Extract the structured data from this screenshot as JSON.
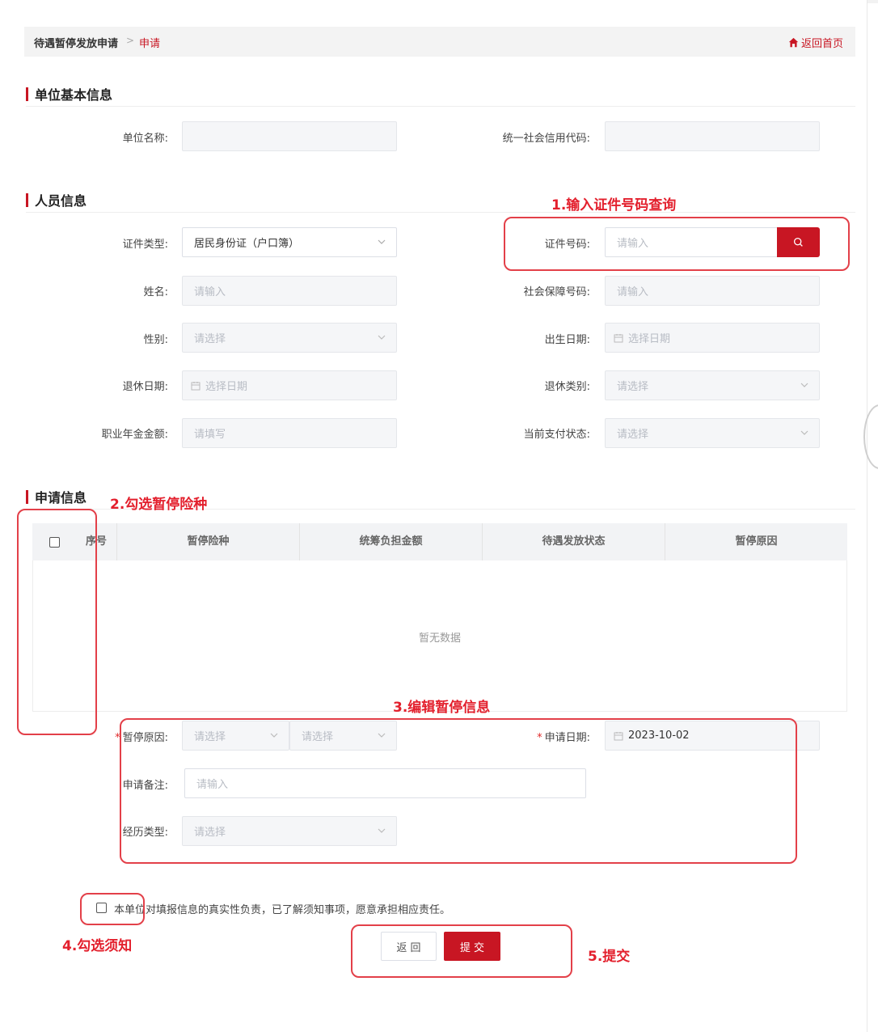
{
  "breadcrumb": {
    "parent": "待遇暂停发放申请",
    "separator": ">",
    "current": "申请",
    "home_link": "返回首页"
  },
  "sections": {
    "unit_info": "单位基本信息",
    "person_info": "人员信息",
    "apply_info": "申请信息"
  },
  "unit": {
    "name_label": "单位名称:",
    "name_value": "",
    "credit_code_label": "统一社会信用代码:",
    "credit_code_value": ""
  },
  "person": {
    "id_type_label": "证件类型:",
    "id_type_value": "居民身份证（户口簿）",
    "id_number_label": "证件号码:",
    "id_number_placeholder": "请输入",
    "name_label": "姓名:",
    "name_placeholder": "请输入",
    "ssn_label": "社会保障号码:",
    "ssn_placeholder": "请输入",
    "gender_label": "性别:",
    "gender_placeholder": "请选择",
    "birth_label": "出生日期:",
    "birth_placeholder": "选择日期",
    "retire_date_label": "退休日期:",
    "retire_date_placeholder": "选择日期",
    "retire_type_label": "退休类别:",
    "retire_type_placeholder": "请选择",
    "annuity_label": "职业年金金额:",
    "annuity_placeholder": "请填写",
    "pay_status_label": "当前支付状态:",
    "pay_status_placeholder": "请选择"
  },
  "table": {
    "columns": [
      "序号",
      "暂停险种",
      "统筹负担金额",
      "待遇发放状态",
      "暂停原因"
    ],
    "empty_text": "暂无数据"
  },
  "apply": {
    "reason_label": "暂停原因:",
    "reason_placeholder1": "请选择",
    "reason_placeholder2": "请选择",
    "date_label": "申请日期:",
    "date_value": "2023-10-02",
    "remark_label": "申请备注:",
    "remark_placeholder": "请输入",
    "exp_type_label": "经历类型:",
    "exp_type_placeholder": "请选择"
  },
  "agreement": {
    "text": "本单位对填报信息的真实性负责，已了解须知事项，愿意承担相应责任。"
  },
  "buttons": {
    "back": "返 回",
    "submit": "提 交"
  },
  "annotations": {
    "step1": "1.输入证件号码查询",
    "step2": "2.勾选暂停险种",
    "step3": "3.编辑暂停信息",
    "step4": "4.勾选须知",
    "step5": "5.提交"
  },
  "colors": {
    "brand_red": "#c81623",
    "annotation_red": "#e3202d",
    "field_bg": "#f5f6f8"
  }
}
